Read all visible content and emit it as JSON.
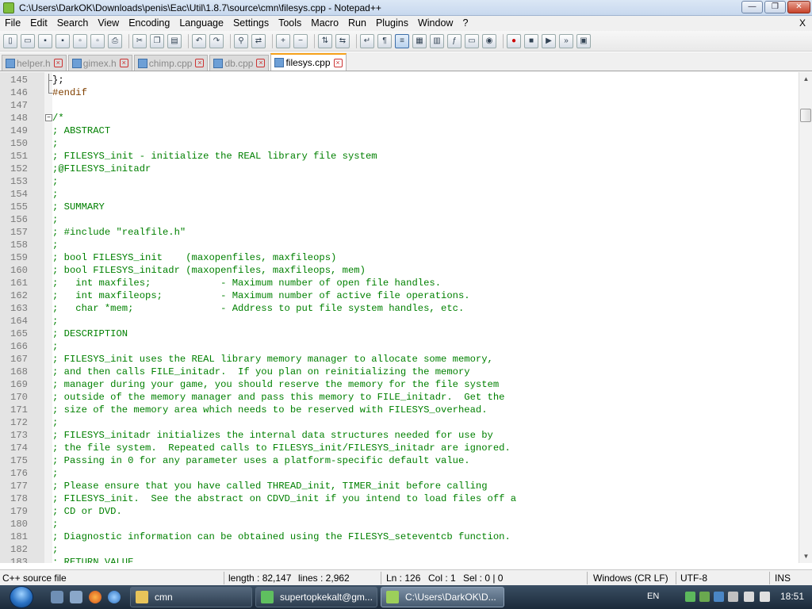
{
  "window": {
    "title": "C:\\Users\\DarkOK\\Downloads\\penis\\Eac\\Util\\1.8.7\\source\\cmn\\filesys.cpp - Notepad++",
    "minimize": "—",
    "maximize": "❐",
    "close": "✕"
  },
  "menu": {
    "items": [
      "File",
      "Edit",
      "Search",
      "View",
      "Encoding",
      "Language",
      "Settings",
      "Tools",
      "Macro",
      "Run",
      "Plugins",
      "Window",
      "?"
    ],
    "close_doc": "X"
  },
  "toolbar": {
    "icons": [
      "new-file-icon",
      "open-file-icon",
      "save-icon",
      "save-all-icon",
      "close-icon",
      "close-all-icon",
      "print-icon",
      "cut-icon",
      "copy-icon",
      "paste-icon",
      "undo-icon",
      "redo-icon",
      "find-icon",
      "replace-icon",
      "zoom-in-icon",
      "zoom-out-icon",
      "sync-vertical-icon",
      "sync-horizontal-icon",
      "word-wrap-icon",
      "show-all-chars-icon",
      "indent-guide-icon",
      "user-defined-lang-icon",
      "doc-map-icon",
      "function-list-icon",
      "folder-workspace-icon",
      "monitoring-icon",
      "record-macro-icon",
      "stop-record-icon",
      "play-macro-icon",
      "play-multiple-icon",
      "save-macro-icon"
    ]
  },
  "tabs": [
    {
      "label": "helper.h",
      "active": false
    },
    {
      "label": "gimex.h",
      "active": false
    },
    {
      "label": "chimp.cpp",
      "active": false
    },
    {
      "label": "db.cpp",
      "active": false
    },
    {
      "label": "filesys.cpp",
      "active": true
    }
  ],
  "editor": {
    "lines": [
      {
        "n": "145",
        "text": "};",
        "kind": "plain",
        "fold": "end"
      },
      {
        "n": "146",
        "text": "#endif",
        "kind": "pp",
        "fold": "corner"
      },
      {
        "n": "147",
        "text": "",
        "kind": "plain",
        "fold": ""
      },
      {
        "n": "148",
        "text": "/*",
        "kind": "comment",
        "fold": "box"
      },
      {
        "n": "149",
        "text": "; ABSTRACT",
        "kind": "comment",
        "fold": ""
      },
      {
        "n": "150",
        "text": ";",
        "kind": "comment",
        "fold": ""
      },
      {
        "n": "151",
        "text": "; FILESYS_init - initialize the REAL library file system",
        "kind": "comment",
        "fold": ""
      },
      {
        "n": "152",
        "text": ";@FILESYS_initadr",
        "kind": "comment",
        "fold": ""
      },
      {
        "n": "153",
        "text": ";",
        "kind": "comment",
        "fold": ""
      },
      {
        "n": "154",
        "text": ";",
        "kind": "comment",
        "fold": ""
      },
      {
        "n": "155",
        "text": "; SUMMARY",
        "kind": "comment",
        "fold": ""
      },
      {
        "n": "156",
        "text": ";",
        "kind": "comment",
        "fold": ""
      },
      {
        "n": "157",
        "text": "; #include \"realfile.h\"",
        "kind": "comment",
        "fold": ""
      },
      {
        "n": "158",
        "text": ";",
        "kind": "comment",
        "fold": ""
      },
      {
        "n": "159",
        "text": "; bool FILESYS_init    (maxopenfiles, maxfileops)",
        "kind": "comment",
        "fold": ""
      },
      {
        "n": "160",
        "text": "; bool FILESYS_initadr (maxopenfiles, maxfileops, mem)",
        "kind": "comment",
        "fold": ""
      },
      {
        "n": "161",
        "text": ";   int maxfiles;            - Maximum number of open file handles.",
        "kind": "comment",
        "fold": ""
      },
      {
        "n": "162",
        "text": ";   int maxfileops;          - Maximum number of active file operations.",
        "kind": "comment",
        "fold": ""
      },
      {
        "n": "163",
        "text": ";   char *mem;               - Address to put file system handles, etc.",
        "kind": "comment",
        "fold": ""
      },
      {
        "n": "164",
        "text": ";",
        "kind": "comment",
        "fold": ""
      },
      {
        "n": "165",
        "text": "; DESCRIPTION",
        "kind": "comment",
        "fold": ""
      },
      {
        "n": "166",
        "text": ";",
        "kind": "comment",
        "fold": ""
      },
      {
        "n": "167",
        "text": "; FILESYS_init uses the REAL library memory manager to allocate some memory,",
        "kind": "comment",
        "fold": ""
      },
      {
        "n": "168",
        "text": "; and then calls FILE_initadr.  If you plan on reinitializing the memory",
        "kind": "comment",
        "fold": ""
      },
      {
        "n": "169",
        "text": "; manager during your game, you should reserve the memory for the file system",
        "kind": "comment",
        "fold": ""
      },
      {
        "n": "170",
        "text": "; outside of the memory manager and pass this memory to FILE_initadr.  Get the",
        "kind": "comment",
        "fold": ""
      },
      {
        "n": "171",
        "text": "; size of the memory area which needs to be reserved with FILESYS_overhead.",
        "kind": "comment",
        "fold": ""
      },
      {
        "n": "172",
        "text": ";",
        "kind": "comment",
        "fold": ""
      },
      {
        "n": "173",
        "text": "; FILESYS_initadr initializes the internal data structures needed for use by",
        "kind": "comment",
        "fold": ""
      },
      {
        "n": "174",
        "text": "; the file system.  Repeated calls to FILESYS_init/FILESYS_initadr are ignored.",
        "kind": "comment",
        "fold": ""
      },
      {
        "n": "175",
        "text": "; Passing in 0 for any parameter uses a platform-specific default value.",
        "kind": "comment",
        "fold": ""
      },
      {
        "n": "176",
        "text": ";",
        "kind": "comment",
        "fold": ""
      },
      {
        "n": "177",
        "text": "; Please ensure that you have called THREAD_init, TIMER_init before calling",
        "kind": "comment",
        "fold": ""
      },
      {
        "n": "178",
        "text": "; FILESYS_init.  See the abstract on CDVD_init if you intend to load files off a",
        "kind": "comment",
        "fold": ""
      },
      {
        "n": "179",
        "text": "; CD or DVD.",
        "kind": "comment",
        "fold": ""
      },
      {
        "n": "180",
        "text": ";",
        "kind": "comment",
        "fold": ""
      },
      {
        "n": "181",
        "text": "; Diagnostic information can be obtained using the FILESYS_seteventcb function.",
        "kind": "comment",
        "fold": ""
      },
      {
        "n": "182",
        "text": ";",
        "kind": "comment",
        "fold": ""
      },
      {
        "n": "183",
        "text": "; RETURN VALUE",
        "kind": "comment",
        "fold": ""
      }
    ]
  },
  "status": {
    "language": "C++ source file",
    "length": "length : 82,147",
    "lines": "lines : 2,962",
    "ln": "Ln : 126",
    "col": "Col : 1",
    "sel": "Sel : 0 | 0",
    "eol": "Windows (CR LF)",
    "encoding": "UTF-8",
    "mode": "INS"
  },
  "taskbar": {
    "tasks": [
      {
        "label": "cmn",
        "icon": "folder-icon",
        "active": false
      },
      {
        "label": "supertopkekalt@gm...",
        "icon": "messenger-icon",
        "active": false
      },
      {
        "label": "C:\\Users\\DarkOK\\D...",
        "icon": "notepadpp-icon",
        "active": true
      }
    ],
    "lang": "EN",
    "clock": "18:51"
  }
}
